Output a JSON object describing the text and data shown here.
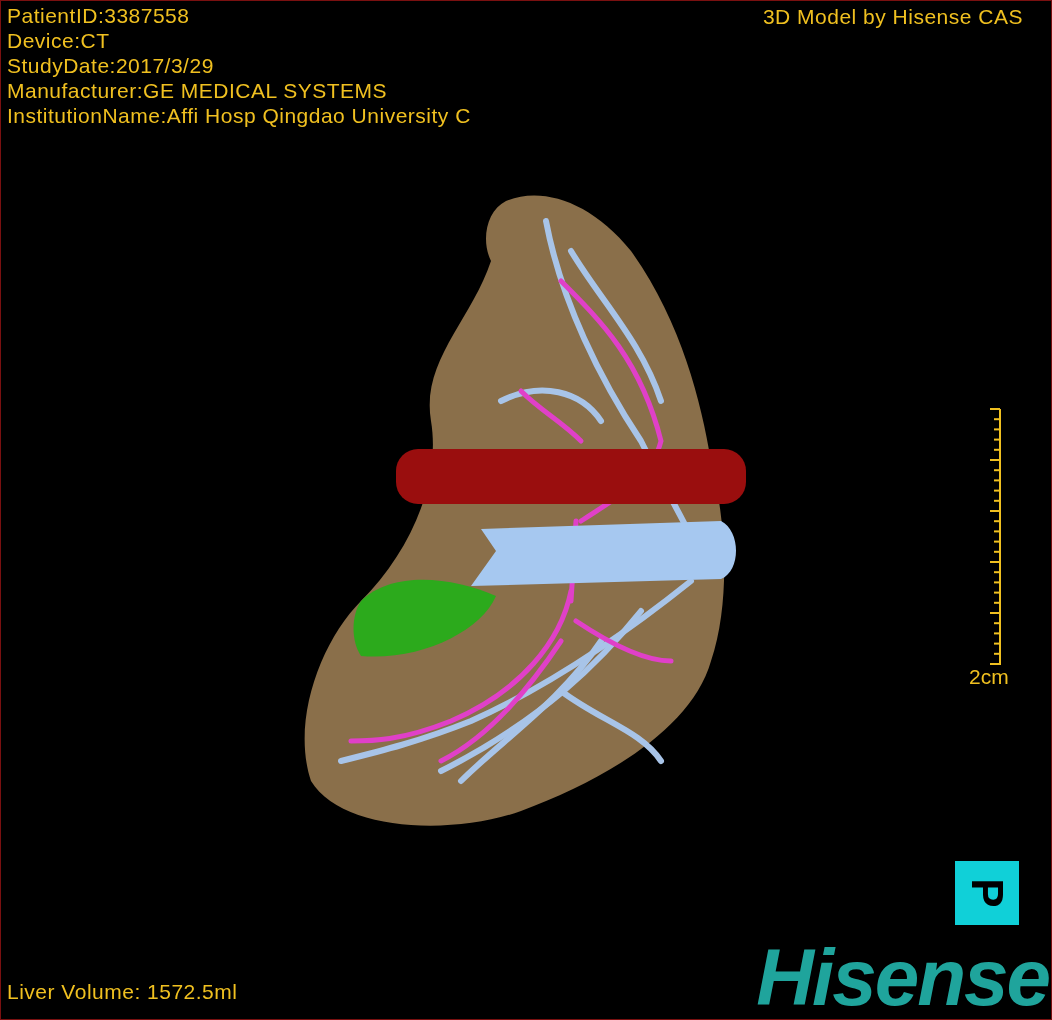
{
  "info_lines": [
    "PatientID:3387558",
    "Device:CT",
    "StudyDate:2017/3/29",
    "Manufacturer:GE MEDICAL SYSTEMS",
    "InstitutionName:Affi Hosp Qingdao University C"
  ],
  "top_right_label": "3D Model by Hisense CAS",
  "scale_bar": {
    "label": "2cm"
  },
  "orientation_marker": {
    "label": "P"
  },
  "liver_volume": "Liver Volume: 1572.5ml",
  "logo": "Hisense"
}
